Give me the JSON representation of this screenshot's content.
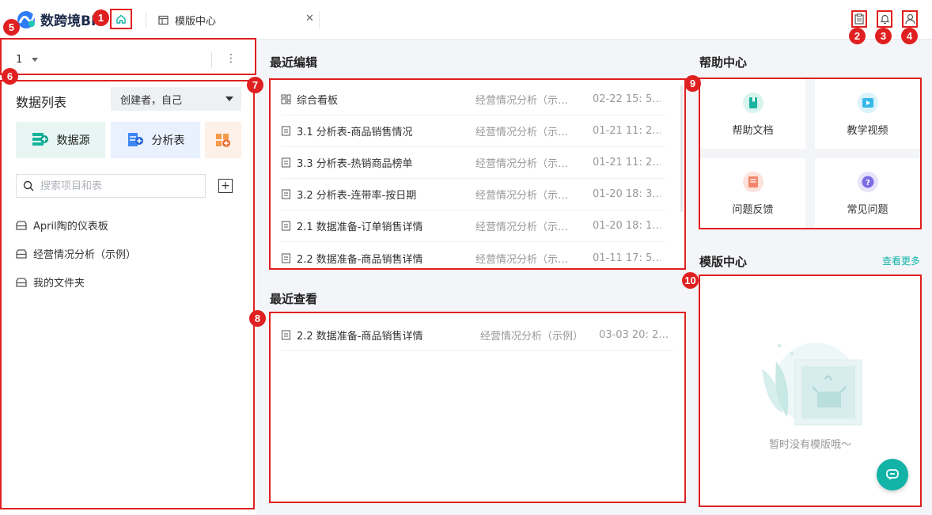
{
  "app": {
    "logo_text": "数跨境BI"
  },
  "tabs": [
    {
      "label": "模版中心"
    }
  ],
  "markers": [
    "1",
    "2",
    "3",
    "4",
    "5",
    "6",
    "7",
    "8",
    "9",
    "10"
  ],
  "left": {
    "selector_value": "1",
    "list_title": "数据列表",
    "creator_filter": "创建者，自己",
    "buttons": {
      "datasource": "数据源",
      "analysis": "分析表"
    },
    "search_placeholder": "搜索项目和表",
    "folders": [
      "April陶的仪表板",
      "经营情况分析（示例）",
      "我的文件夹"
    ]
  },
  "recent_edit": {
    "title": "最近编辑",
    "rows": [
      {
        "icon": "dashboard-icon",
        "name": "综合看板",
        "folder": "经营情况分析（示…",
        "time": "02-22 15: 5…"
      },
      {
        "icon": "sheet-icon",
        "name": "3.1  分析表-商品销售情况",
        "folder": "经营情况分析（示…",
        "time": "01-21 11: 2…"
      },
      {
        "icon": "sheet-icon",
        "name": "3.3 分析表-热销商品榜单",
        "folder": "经营情况分析（示…",
        "time": "01-21 11: 2…"
      },
      {
        "icon": "sheet-icon",
        "name": "3.2 分析表-连带率-按日期",
        "folder": "经营情况分析（示…",
        "time": "01-20 18: 3…"
      },
      {
        "icon": "sheet-icon",
        "name": "2.1 数据准备-订单销售详情",
        "folder": "经营情况分析（示…",
        "time": "01-20 18: 1…"
      },
      {
        "icon": "sheet-icon",
        "name": "2.2 数据准备-商品销售详情",
        "folder": "经营情况分析（示…",
        "time": "01-11 17: 5…"
      }
    ]
  },
  "recent_view": {
    "title": "最近查看",
    "rows": [
      {
        "icon": "sheet-icon",
        "name": "2.2 数据准备-商品销售详情",
        "folder": "经营情况分析（示例）",
        "time": "03-03 20: 2…"
      }
    ]
  },
  "help": {
    "title": "帮助中心",
    "tiles": [
      "帮助文档",
      "教学视频",
      "问题反馈",
      "常见问题"
    ]
  },
  "templates": {
    "title": "模版中心",
    "more_link": "查看更多",
    "empty_text": "暂时没有模版哦～"
  },
  "colors": {
    "accent": "#13b3a8",
    "marker": "#e02020"
  }
}
